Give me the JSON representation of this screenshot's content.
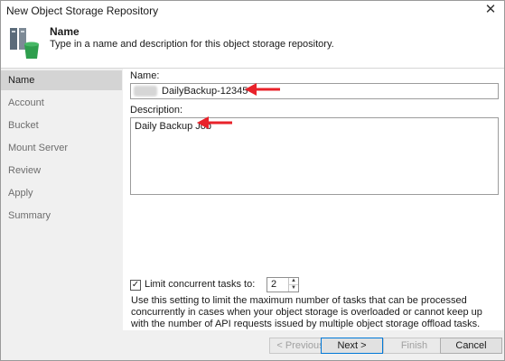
{
  "window": {
    "title": "New Object Storage Repository",
    "close_glyph": "✕"
  },
  "header": {
    "title": "Name",
    "description": "Type in a name and description for this object storage repository.",
    "icon": "object-storage-icon"
  },
  "sidebar": {
    "items": [
      {
        "label": "Name",
        "active": true
      },
      {
        "label": "Account",
        "active": false
      },
      {
        "label": "Bucket",
        "active": false
      },
      {
        "label": "Mount Server",
        "active": false
      },
      {
        "label": "Review",
        "active": false
      },
      {
        "label": "Apply",
        "active": false
      },
      {
        "label": "Summary",
        "active": false
      }
    ]
  },
  "form": {
    "name_label": "Name:",
    "name_value": "DailyBackup-12345",
    "description_label": "Description:",
    "description_value": "Daily Backup Job",
    "limit_checked": true,
    "limit_check_glyph": "✓",
    "limit_label": "Limit concurrent tasks to:",
    "limit_value": "2",
    "help_text": "Use this setting to limit the maximum number of tasks that can be processed concurrently in cases when your object storage is overloaded or cannot keep up with the number of API requests issued by multiple object storage offload tasks."
  },
  "footer": {
    "previous_label": "< Previous",
    "next_label": "Next >",
    "finish_label": "Finish",
    "cancel_label": "Cancel"
  },
  "colors": {
    "annotation_arrow": "#e8222a",
    "icon_green": "#2e9e4d",
    "active_border": "#0078d7"
  }
}
